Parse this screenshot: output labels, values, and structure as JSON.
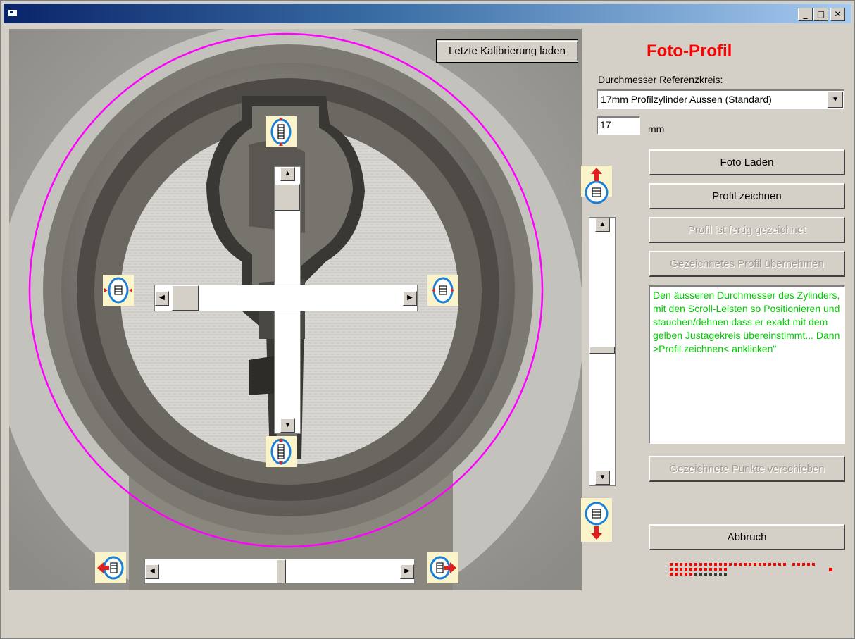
{
  "window": {
    "title": "",
    "controls": {
      "minimize": "_",
      "maximize": "□",
      "close": "✕"
    }
  },
  "photo": {
    "load_calibration_button": "Letzte Kalibrierung laden",
    "circle_color": "#ff00ff"
  },
  "panel": {
    "heading": "Foto-Profil",
    "diameter_label": "Durchmesser Referenzkreis:",
    "diameter_select": "17mm Profilzylinder Aussen (Standard)",
    "diameter_value": "17",
    "unit": "mm",
    "load_photo_button": "Foto Laden",
    "draw_profile_button": "Profil zeichnen",
    "profile_done_button": "Profil ist fertig gezeichnet",
    "apply_profile_button": "Gezeichnetes Profil übernehmen",
    "instructions": "Den äusseren Durchmesser des Zylinders, mit den Scroll-Leisten so Positionieren und stauchen/dehnen dass er exakt mit dem gelben Justagekreis übereinstimmt... Dann >Profil zeichnen< anklicken\"",
    "move_points_button": "Gezeichnete Punkte verschieben",
    "cancel_button": "Abbruch"
  },
  "icons": {
    "scroll_up": "▲",
    "scroll_down": "▼",
    "scroll_left": "◀",
    "scroll_right": "▶",
    "combo_arrow": "▼"
  },
  "colors": {
    "accent_red": "#ff0000",
    "instruction_green": "#00cc00",
    "arrow_bg": "#fbf3c9",
    "arrow_blue": "#1a7fd6"
  }
}
